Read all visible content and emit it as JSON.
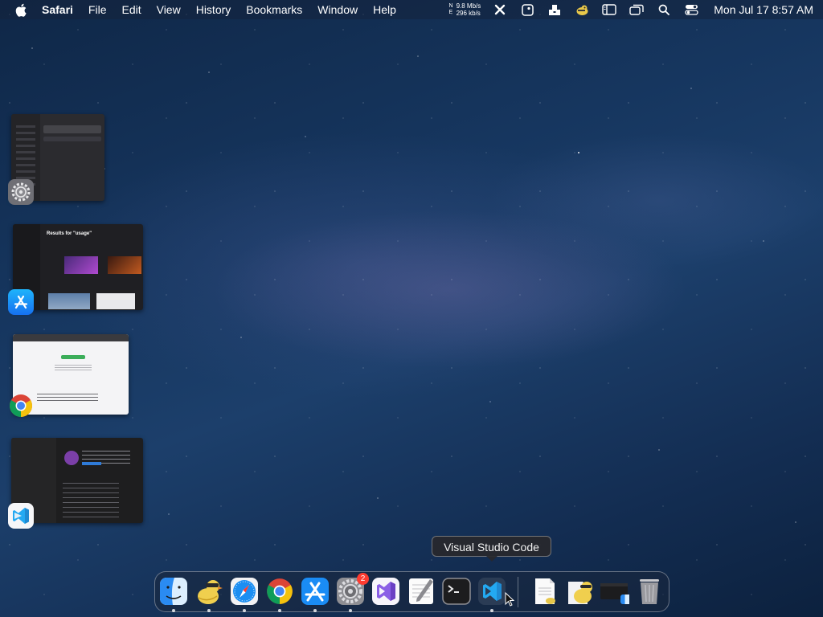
{
  "menubar": {
    "app_name": "Safari",
    "items": [
      "File",
      "Edit",
      "View",
      "History",
      "Bookmarks",
      "Window",
      "Help"
    ],
    "net_arrow_up": "N",
    "net_arrow_down": "E",
    "net_up": "9.8 Mb/s",
    "net_down": "296 kb/s",
    "status_icons": [
      "tools-icon",
      "dashboard-icon",
      "inbox-icon",
      "cyberduck-icon",
      "sidebar-icon",
      "windows-icon",
      "search-icon",
      "control-center-icon"
    ],
    "clock": "Mon Jul 17  8:57 AM"
  },
  "stage_manager": [
    {
      "app": "System Settings",
      "icon": "system-settings-icon"
    },
    {
      "app": "App Store",
      "icon": "app-store-icon",
      "thumb_title": "Results for \"usage\""
    },
    {
      "app": "Google Chrome",
      "icon": "chrome-icon"
    },
    {
      "app": "Visual Studio Code",
      "icon": "vscode-icon"
    }
  ],
  "tooltip": {
    "text": "Visual Studio Code"
  },
  "dock": {
    "apps": [
      {
        "name": "Finder",
        "icon": "finder-icon",
        "running": true
      },
      {
        "name": "Cyberduck",
        "icon": "cyberduck-icon",
        "running": true
      },
      {
        "name": "Safari",
        "icon": "safari-icon",
        "running": true
      },
      {
        "name": "Google Chrome",
        "icon": "chrome-icon",
        "running": true
      },
      {
        "name": "App Store",
        "icon": "app-store-icon",
        "running": true
      },
      {
        "name": "System Settings",
        "icon": "system-settings-icon",
        "running": true,
        "badge": "2"
      },
      {
        "name": "Visual Studio",
        "icon": "visual-studio-icon",
        "running": false
      },
      {
        "name": "TextEdit",
        "icon": "textedit-icon",
        "running": false
      },
      {
        "name": "Terminal",
        "icon": "terminal-icon",
        "running": false
      },
      {
        "name": "Visual Studio Code",
        "icon": "vscode-icon",
        "running": true
      }
    ],
    "extras": [
      {
        "name": "Document",
        "icon": "document-icon"
      },
      {
        "name": "Cyberduck Document",
        "icon": "cyberduck-doc-icon"
      },
      {
        "name": "Finder Window",
        "icon": "finder-window-icon"
      },
      {
        "name": "Trash",
        "icon": "trash-icon"
      }
    ]
  },
  "colors": {
    "menubar_bg": "#1a2c48",
    "badge": "#ff3b30",
    "vscode_blue": "#23a9f2",
    "safari_blue": "#1b8ef2"
  }
}
